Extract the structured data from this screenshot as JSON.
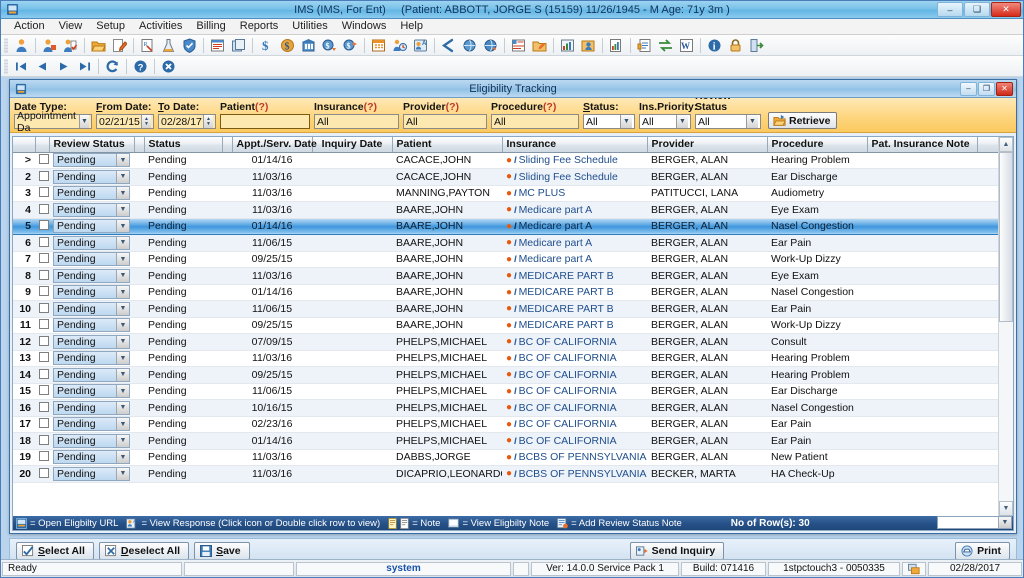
{
  "titlebar": {
    "app_title": "IMS (IMS, For Ent)",
    "patient_info": "(Patient: ABBOTT, JORGE S (15159) 11/26/1945 - M Age: 71y 3m )",
    "minimize": "–",
    "maximize": "❑",
    "close": "✕"
  },
  "menubar": {
    "items": [
      "Action",
      "View",
      "Setup",
      "Activities",
      "Billing",
      "Reports",
      "Utilities",
      "Windows",
      "Help"
    ]
  },
  "window": {
    "title": "Eligibility Tracking",
    "minimize": "–",
    "restore": "❐",
    "close": "✕"
  },
  "filters": {
    "date_type": {
      "label": "Date Type:",
      "value": "Appointment Da"
    },
    "from_date": {
      "label": "From Date:",
      "value": "02/21/15"
    },
    "to_date": {
      "label": "To Date:",
      "value": "02/28/17"
    },
    "patient": {
      "label": "Patient",
      "hint": "(?)",
      "value": ""
    },
    "insurance": {
      "label": "Insurance",
      "hint": "(?)",
      "value": "All"
    },
    "provider": {
      "label": "Provider",
      "hint": "(?)",
      "value": "All"
    },
    "procedure": {
      "label": "Procedure",
      "hint": "(?)",
      "value": "All"
    },
    "status": {
      "label": "Status:",
      "value": "All"
    },
    "ins_priority": {
      "label": "Ins.Priority:",
      "value": "All"
    },
    "review_status": {
      "label": "Review Status",
      "value": "All"
    },
    "retrieve_label": "Retrieve"
  },
  "grid": {
    "columns": [
      "",
      "",
      "Review Status",
      "",
      "Status",
      "",
      "Appt./Serv. Date",
      "Inquiry Date",
      "Patient",
      "Insurance",
      "Provider",
      "Procedure",
      "Pat. Insurance Note",
      ""
    ],
    "rows": [
      {
        "num": ">",
        "review": "Pending",
        "status": "Pending",
        "appt": "01/14/16",
        "inquiry": "",
        "patient": "CACACE,JOHN",
        "insurance": "Sliding Fee Schedule",
        "provider": "BERGER, ALAN",
        "procedure": "Hearing Problem",
        "note": "",
        "selected": false
      },
      {
        "num": "2",
        "review": "Pending",
        "status": "Pending",
        "appt": "11/03/16",
        "inquiry": "",
        "patient": "CACACE,JOHN",
        "insurance": "Sliding Fee Schedule",
        "provider": "BERGER, ALAN",
        "procedure": "Ear Discharge",
        "note": "",
        "selected": false
      },
      {
        "num": "3",
        "review": "Pending",
        "status": "Pending",
        "appt": "11/03/16",
        "inquiry": "",
        "patient": "MANNING,PAYTON",
        "insurance": "MC PLUS",
        "provider": "PATITUCCI, LANA",
        "procedure": "Audiometry",
        "note": "",
        "selected": false
      },
      {
        "num": "4",
        "review": "Pending",
        "status": "Pending",
        "appt": "11/03/16",
        "inquiry": "",
        "patient": "BAARE,JOHN",
        "insurance": "Medicare part A",
        "provider": "BERGER, ALAN",
        "procedure": "Eye Exam",
        "note": "",
        "selected": false
      },
      {
        "num": "5",
        "review": "Pending",
        "status": "Pending",
        "appt": "01/14/16",
        "inquiry": "",
        "patient": "BAARE,JOHN",
        "insurance": "Medicare part A",
        "provider": "BERGER, ALAN",
        "procedure": "Nasel Congestion",
        "note": "",
        "selected": true
      },
      {
        "num": "6",
        "review": "Pending",
        "status": "Pending",
        "appt": "11/06/15",
        "inquiry": "",
        "patient": "BAARE,JOHN",
        "insurance": "Medicare part A",
        "provider": "BERGER, ALAN",
        "procedure": "Ear Pain",
        "note": "",
        "selected": false
      },
      {
        "num": "7",
        "review": "Pending",
        "status": "Pending",
        "appt": "09/25/15",
        "inquiry": "",
        "patient": "BAARE,JOHN",
        "insurance": "Medicare part A",
        "provider": "BERGER, ALAN",
        "procedure": "Work-Up Dizzy",
        "note": "",
        "selected": false
      },
      {
        "num": "8",
        "review": "Pending",
        "status": "Pending",
        "appt": "11/03/16",
        "inquiry": "",
        "patient": "BAARE,JOHN",
        "insurance": "MEDICARE PART B",
        "provider": "BERGER, ALAN",
        "procedure": "Eye Exam",
        "note": "",
        "selected": false
      },
      {
        "num": "9",
        "review": "Pending",
        "status": "Pending",
        "appt": "01/14/16",
        "inquiry": "",
        "patient": "BAARE,JOHN",
        "insurance": "MEDICARE PART B",
        "provider": "BERGER, ALAN",
        "procedure": "Nasel Congestion",
        "note": "",
        "selected": false
      },
      {
        "num": "10",
        "review": "Pending",
        "status": "Pending",
        "appt": "11/06/15",
        "inquiry": "",
        "patient": "BAARE,JOHN",
        "insurance": "MEDICARE PART B",
        "provider": "BERGER, ALAN",
        "procedure": "Ear Pain",
        "note": "",
        "selected": false
      },
      {
        "num": "11",
        "review": "Pending",
        "status": "Pending",
        "appt": "09/25/15",
        "inquiry": "",
        "patient": "BAARE,JOHN",
        "insurance": "MEDICARE PART B",
        "provider": "BERGER, ALAN",
        "procedure": "Work-Up Dizzy",
        "note": "",
        "selected": false
      },
      {
        "num": "12",
        "review": "Pending",
        "status": "Pending",
        "appt": "07/09/15",
        "inquiry": "",
        "patient": "PHELPS,MICHAEL",
        "insurance": "BC OF CALIFORNIA",
        "provider": "BERGER, ALAN",
        "procedure": "Consult",
        "note": "",
        "selected": false
      },
      {
        "num": "13",
        "review": "Pending",
        "status": "Pending",
        "appt": "11/03/16",
        "inquiry": "",
        "patient": "PHELPS,MICHAEL",
        "insurance": "BC OF CALIFORNIA",
        "provider": "BERGER, ALAN",
        "procedure": "Hearing Problem",
        "note": "",
        "selected": false
      },
      {
        "num": "14",
        "review": "Pending",
        "status": "Pending",
        "appt": "09/25/15",
        "inquiry": "",
        "patient": "PHELPS,MICHAEL",
        "insurance": "BC OF CALIFORNIA",
        "provider": "BERGER, ALAN",
        "procedure": "Hearing Problem",
        "note": "",
        "selected": false
      },
      {
        "num": "15",
        "review": "Pending",
        "status": "Pending",
        "appt": "11/06/15",
        "inquiry": "",
        "patient": "PHELPS,MICHAEL",
        "insurance": "BC OF CALIFORNIA",
        "provider": "BERGER, ALAN",
        "procedure": "Ear Discharge",
        "note": "",
        "selected": false
      },
      {
        "num": "16",
        "review": "Pending",
        "status": "Pending",
        "appt": "10/16/15",
        "inquiry": "",
        "patient": "PHELPS,MICHAEL",
        "insurance": "BC OF CALIFORNIA",
        "provider": "BERGER, ALAN",
        "procedure": "Nasel Congestion",
        "note": "",
        "selected": false
      },
      {
        "num": "17",
        "review": "Pending",
        "status": "Pending",
        "appt": "02/23/16",
        "inquiry": "",
        "patient": "PHELPS,MICHAEL",
        "insurance": "BC OF CALIFORNIA",
        "provider": "BERGER, ALAN",
        "procedure": "Ear Pain",
        "note": "",
        "selected": false
      },
      {
        "num": "18",
        "review": "Pending",
        "status": "Pending",
        "appt": "01/14/16",
        "inquiry": "",
        "patient": "PHELPS,MICHAEL",
        "insurance": "BC OF CALIFORNIA",
        "provider": "BERGER, ALAN",
        "procedure": "Ear Pain",
        "note": "",
        "selected": false
      },
      {
        "num": "19",
        "review": "Pending",
        "status": "Pending",
        "appt": "11/03/16",
        "inquiry": "",
        "patient": "DABBS,JORGE",
        "insurance": "BCBS OF PENNSYLVANIA",
        "provider": "BERGER, ALAN",
        "procedure": "New Patient",
        "note": "",
        "selected": false
      },
      {
        "num": "20",
        "review": "Pending",
        "status": "Pending",
        "appt": "11/03/16",
        "inquiry": "",
        "patient": "DICAPRIO,LEONARDO",
        "insurance": "BCBS OF PENNSYLVANIA",
        "provider": "BECKER, MARTA",
        "procedure": "HA Check-Up",
        "note": "",
        "selected": false
      }
    ]
  },
  "legend": {
    "open_url": "= Open Eligbilty URL",
    "view_response": "= View Response (Click icon or Double click row to view)",
    "note": "= Note",
    "view_elig_note": "= View Eligbilty Note",
    "add_review_note": "= Add Review Status Note",
    "row_count": "No of Row(s): 30",
    "end_combo_value": ""
  },
  "buttons": {
    "select_all": "Select All",
    "deselect_all": "Deselect All",
    "save": "Save",
    "send_inquiry": "Send Inquiry",
    "print": "Print"
  },
  "statusbar": {
    "ready": "Ready",
    "blank1": "",
    "system": "system",
    "blank2": "",
    "version": "Ver: 14.0.0 Service Pack 1",
    "build": "Build: 071416",
    "machine": "1stpctouch3 - 0050335",
    "date": "02/28/2017"
  },
  "colors": {
    "title_blue": "#79c2ea",
    "filter_orange": "#fbc95f",
    "legend_blue": "#27528a",
    "selection_blue": "#3f97dd",
    "link_blue": "#1f4e8c",
    "person_orange": "#e8590c",
    "close_red": "#d62b1a"
  }
}
